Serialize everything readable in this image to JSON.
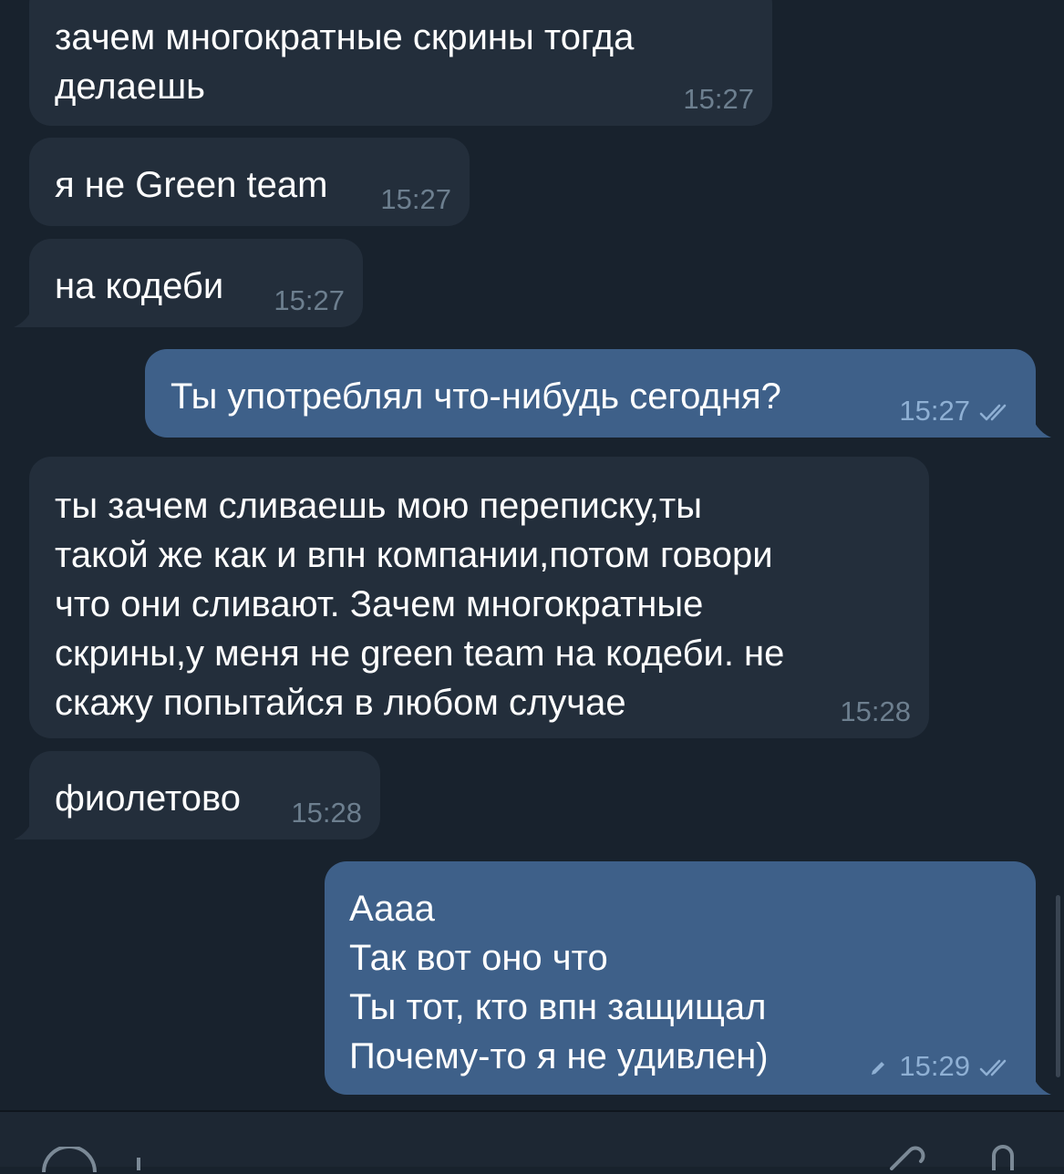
{
  "messages": [
    {
      "direction": "in",
      "text": "зачем многократные скрины тогда\nделаешь",
      "time": "15:27"
    },
    {
      "direction": "in",
      "text": "я не Green team",
      "time": "15:27"
    },
    {
      "direction": "in",
      "text": "на кодеби",
      "time": "15:27"
    },
    {
      "direction": "out",
      "text": "Ты употреблял что-нибудь сегодня?",
      "time": "15:27",
      "status": "read"
    },
    {
      "direction": "in",
      "text": "ты зачем сливаешь мою переписку,ты\nтакой же как и впн компании,потом говори\nчто они сливают. Зачем многократные\nскрины,у меня не green team на кодеби. не\nскажу попытайся   в любом случае",
      "time": "15:28"
    },
    {
      "direction": "in",
      "text": "фиолетово",
      "time": "15:28"
    },
    {
      "direction": "out",
      "text": "Аааа\nТак вот оно что\nТы тот, кто впн защищал\nПочему-то я не удивлен)",
      "time": "15:29",
      "status": "read",
      "edited": true
    }
  ],
  "colors": {
    "background": "#18222d",
    "incoming_bubble": "#232e3b",
    "outgoing_bubble": "#3e6089",
    "text": "#ffffff",
    "incoming_time": "#6d7f8f",
    "outgoing_time": "#8fb0d4",
    "composer": "#1d2733"
  },
  "icons": {
    "read_status": "double-check-icon",
    "edited": "pencil-icon"
  }
}
